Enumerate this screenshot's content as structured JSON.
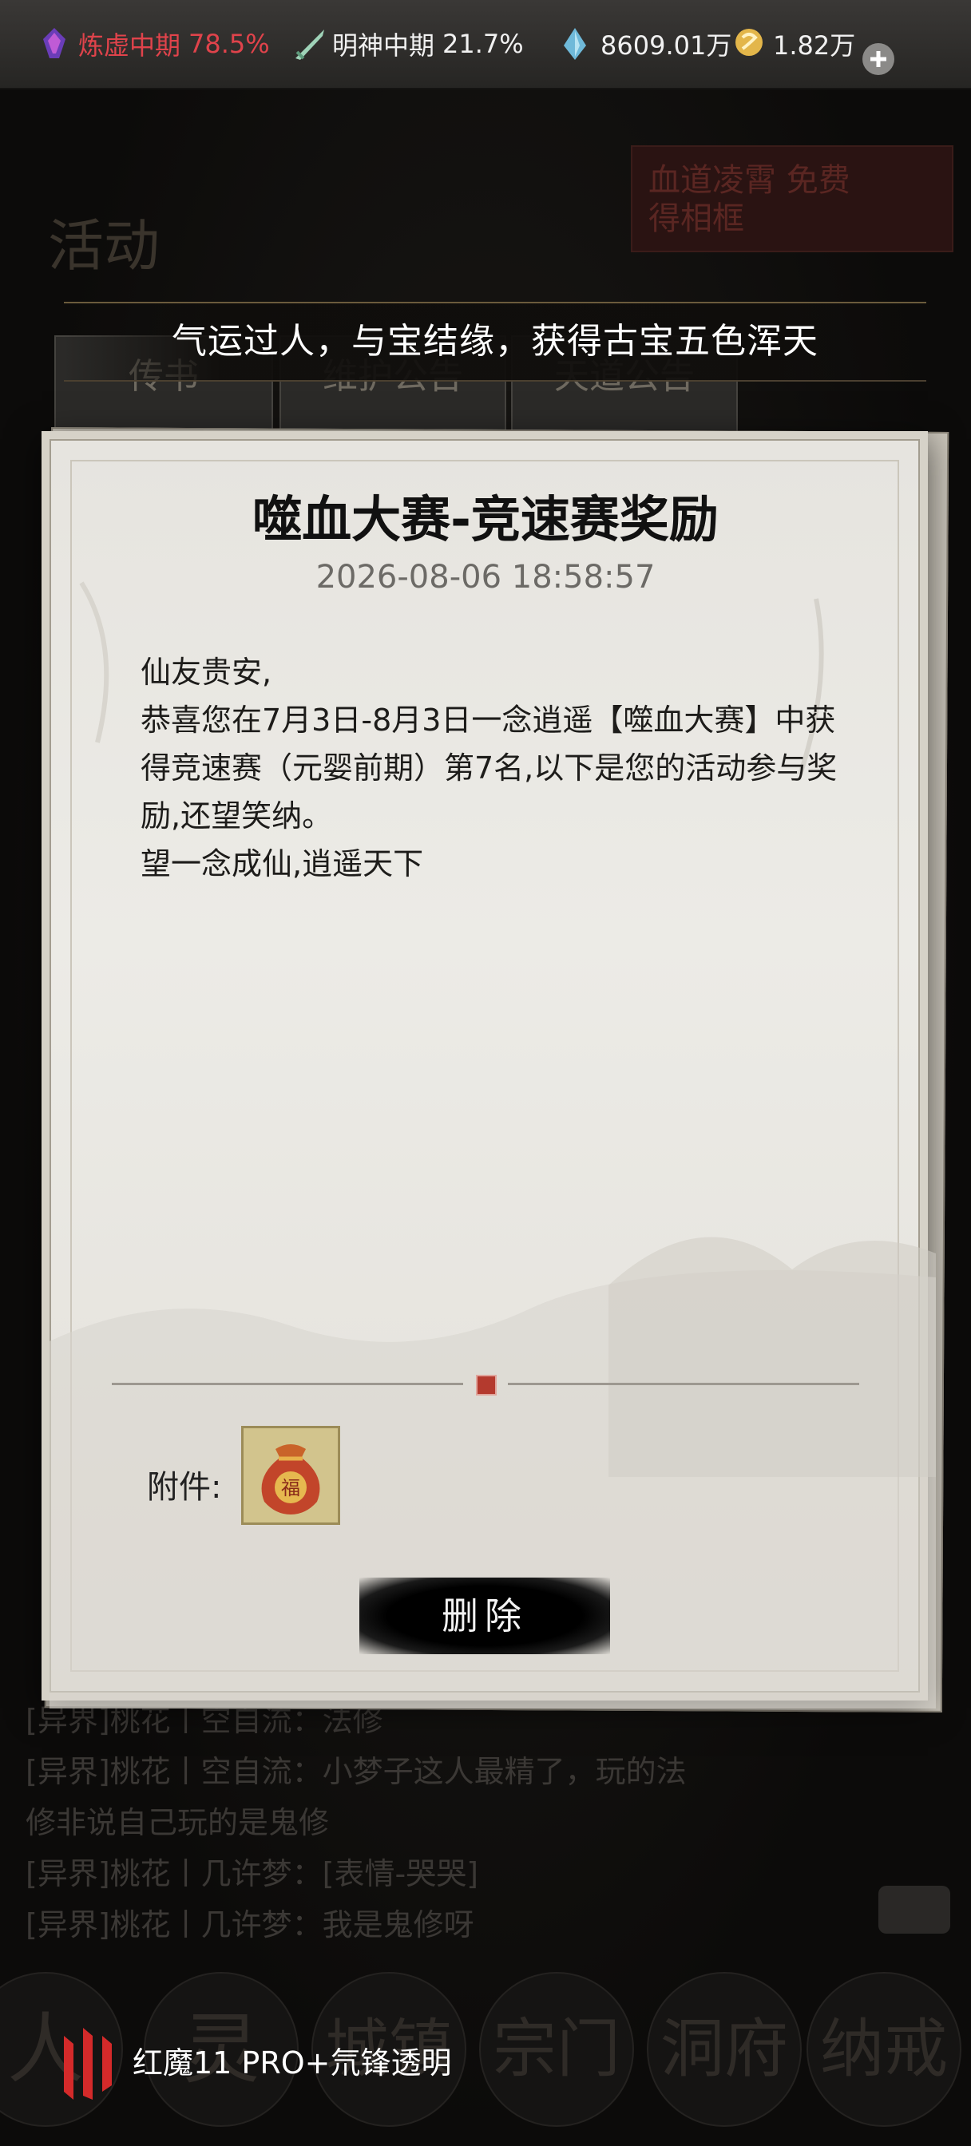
{
  "status_bar": {
    "cultivation": {
      "label": "炼虚中期",
      "value": "78.5%",
      "color": "#e0434b",
      "icon": "cultivation-spirit-icon"
    },
    "soul": {
      "label": "明神中期",
      "value": "21.7%",
      "icon": "sword-icon"
    },
    "spirit_stones": {
      "value": "8609.01万",
      "icon": "spirit-crystal-icon"
    },
    "gold": {
      "value": "1.82万",
      "icon": "gold-coin-icon"
    },
    "add_icon": "plus-icon"
  },
  "background": {
    "activity_label": "活动",
    "promo_text": "血道凌霄 免费得相框",
    "tabs": [
      "传书",
      "维护公告",
      "天道公告"
    ],
    "chat": [
      "[异界]桃花丨空自流：法修",
      "[异界]桃花丨空自流：小梦子这人最精了，玩的法",
      "修非说自己玩的是鬼修",
      "[异界]桃花丨几许梦：[表情-哭哭]",
      "[异界]桃花丨几许梦：我是鬼修呀"
    ],
    "nav": [
      "人",
      "灵",
      "城镇",
      "宗门",
      "洞府",
      "纳戒"
    ]
  },
  "banner": {
    "text": "气运过人，与宝结缘，获得古宝五色浑天"
  },
  "mail": {
    "title": "噬血大赛-竞速赛奖励",
    "date": "2026-08-06 18:58:57",
    "body": [
      "仙友贵安,",
      "恭喜您在7月3日-8月3日一念逍遥【噬血大赛】中获得竞速赛（元婴前期）第7名,以下是您的活动参与奖励,还望笑纳。",
      "望一念成仙,逍遥天下"
    ],
    "attachment_label": "附件:",
    "attachment_icon": "fortune-bag-icon",
    "attachment_glyph": "福",
    "delete_label": "删除"
  },
  "watermark": {
    "text": "红魔11 PRO+氘锋透明",
    "icon": "redmagic-logo-icon"
  }
}
